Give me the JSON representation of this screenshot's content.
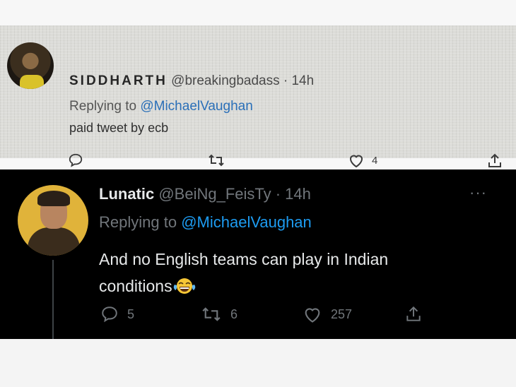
{
  "top_tweet": {
    "name": "SIDDHARTH",
    "handle_time": "@breakingbadass · 14h",
    "replying_label": "Replying to ",
    "mention": "@MichaelVaughan",
    "text": "paid tweet by ecb",
    "actions": {
      "reply_icon": "reply-icon",
      "retweet_icon": "retweet-icon",
      "like_icon": "heart-icon",
      "like_count": "4",
      "share_icon": "share-icon"
    }
  },
  "bottom_tweet": {
    "name": "Lunatic",
    "handle_time": " @BeiNg_FeisTy · 14h",
    "more": "···",
    "replying_label": "Replying to ",
    "mention": "@MichaelVaughan",
    "text_line1": "And no English teams can play in Indian",
    "text_line2": "conditions",
    "emoji": "face-with-tears-of-joy",
    "actions": {
      "reply_count": "5",
      "retweet_count": "6",
      "like_count": "257"
    }
  },
  "colors": {
    "dark_bg": "#000000",
    "dark_text": "#e7e9ea",
    "dark_muted": "#71767b",
    "dark_link": "#1d9bf0",
    "photo_link": "#2a6fb8"
  }
}
